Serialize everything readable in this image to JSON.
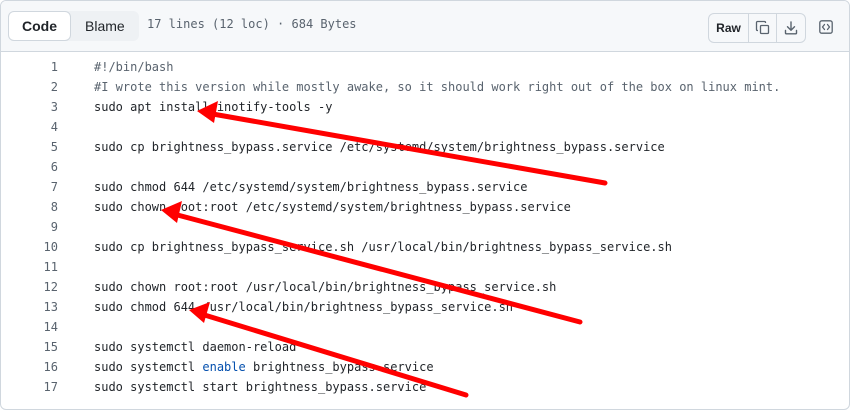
{
  "header": {
    "tab_code": "Code",
    "tab_blame": "Blame",
    "file_info": "17 lines (12 loc) · 684 Bytes",
    "raw_label": "Raw",
    "copy_icon": "copy-icon",
    "download_icon": "download-icon",
    "symbols_icon": "symbols-panel-icon"
  },
  "lines": [
    {
      "n": "1",
      "text": "#!/bin/bash",
      "kind": "comment"
    },
    {
      "n": "2",
      "text": "#I wrote this version while mostly awake, so it should work right out of the box on linux mint.",
      "kind": "comment"
    },
    {
      "n": "3",
      "text": "sudo apt install inotify-tools -y",
      "kind": "code"
    },
    {
      "n": "4",
      "text": "",
      "kind": "code"
    },
    {
      "n": "5",
      "text": "sudo cp brightness_bypass.service /etc/systemd/system/brightness_bypass.service",
      "kind": "code"
    },
    {
      "n": "6",
      "text": "",
      "kind": "code"
    },
    {
      "n": "7",
      "text": "sudo chmod 644 /etc/systemd/system/brightness_bypass.service",
      "kind": "code"
    },
    {
      "n": "8",
      "text": "sudo chown root:root /etc/systemd/system/brightness_bypass.service",
      "kind": "code"
    },
    {
      "n": "9",
      "text": "",
      "kind": "code"
    },
    {
      "n": "10",
      "text": "sudo cp brightness_bypass_service.sh /usr/local/bin/brightness_bypass_service.sh",
      "kind": "code"
    },
    {
      "n": "11",
      "text": "",
      "kind": "code"
    },
    {
      "n": "12",
      "text": "sudo chown root:root /usr/local/bin/brightness_bypass_service.sh",
      "kind": "code"
    },
    {
      "n": "13",
      "text": "sudo chmod 644 /usr/local/bin/brightness_bypass_service.sh",
      "kind": "code"
    },
    {
      "n": "14",
      "text": "",
      "kind": "code"
    },
    {
      "n": "15",
      "text": "sudo systemctl daemon-reload",
      "kind": "code"
    },
    {
      "n": "16",
      "text": "sudo systemctl ",
      "kind": "code",
      "keyword": "enable",
      "rest": " brightness_bypass.service"
    },
    {
      "n": "17",
      "text": "sudo systemctl start brightness_bypass.service",
      "kind": "code"
    }
  ],
  "colors": {
    "arrow": "#ff0000",
    "keyword": "#0550ae",
    "comment": "#59636e",
    "line_number": "#59636e"
  }
}
